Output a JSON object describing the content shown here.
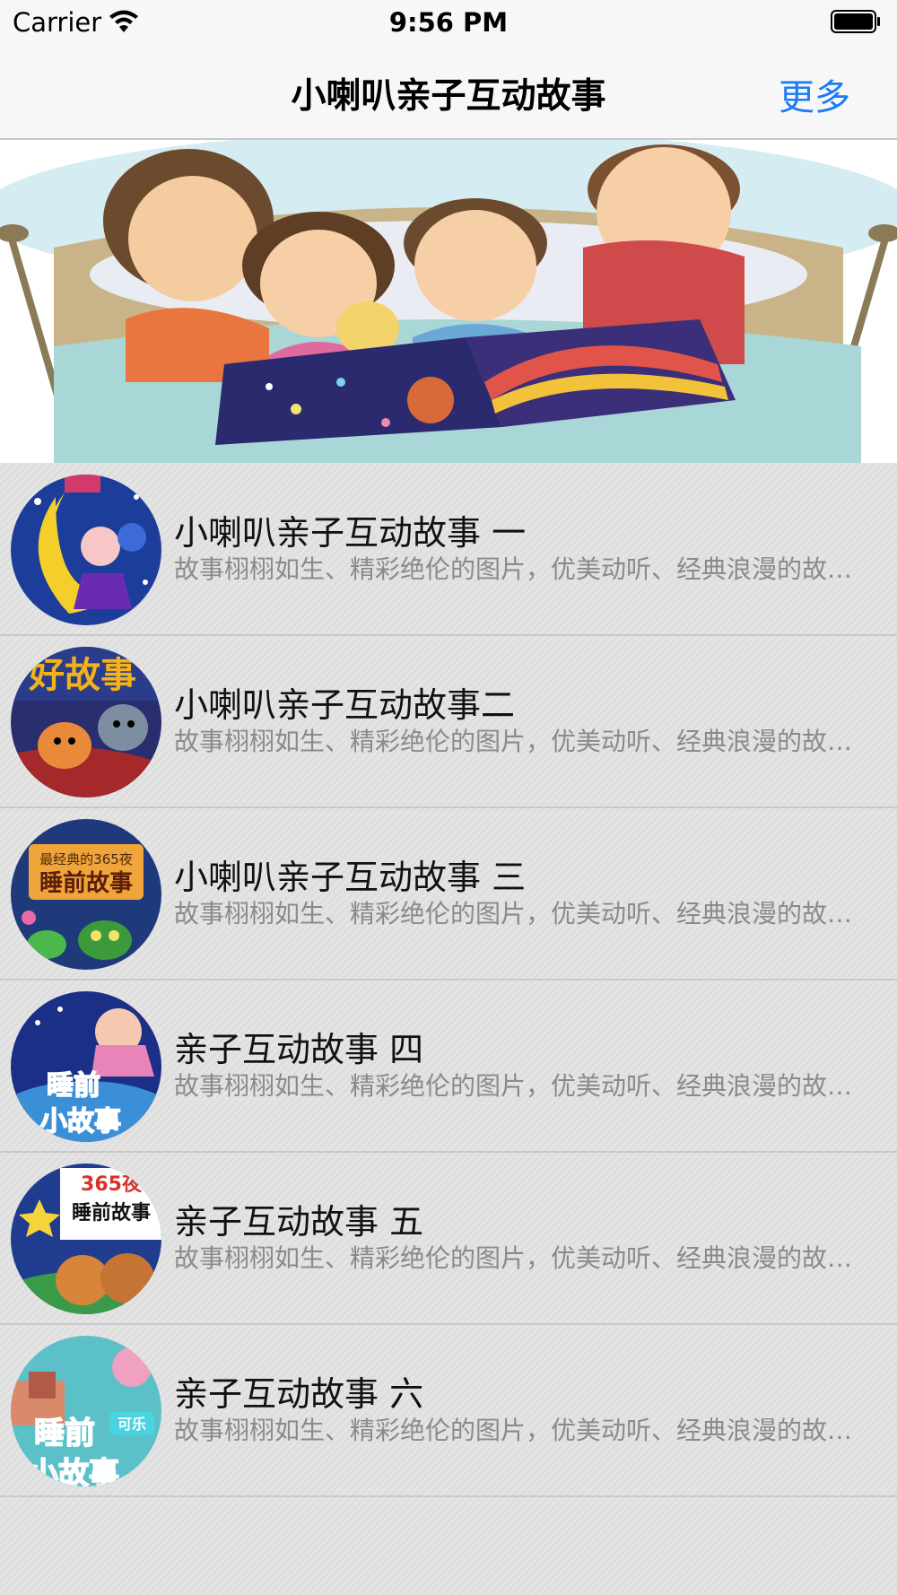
{
  "status_bar": {
    "carrier": "Carrier",
    "time": "9:56 PM",
    "icons": [
      "wifi-icon",
      "battery-icon"
    ]
  },
  "nav": {
    "title": "小喇叭亲子互动故事",
    "more_label": "更多",
    "accent_color": "#1a7cf5"
  },
  "banner": {
    "image": "family-reading-book-illustration"
  },
  "stories": [
    {
      "title": "小喇叭亲子互动故事 一",
      "subtitle": "故事栩栩如生、精彩绝伦的图片，优美动听、经典浪漫的故…",
      "thumb": "moon-children-cover"
    },
    {
      "title": "小喇叭亲子互动故事二",
      "subtitle": "故事栩栩如生、精彩绝伦的图片，优美动听、经典浪漫的故…",
      "thumb": "cats-story-cover",
      "thumb_text": "好故事"
    },
    {
      "title": "小喇叭亲子互动故事 三",
      "subtitle": "故事栩栩如生、精彩绝伦的图片，优美动听、经典浪漫的故…",
      "thumb": "bedtime-stories-365-cover",
      "thumb_text_1": "最经典的365夜",
      "thumb_text_2": "睡前故事"
    },
    {
      "title": "亲子互动故事 四",
      "subtitle": "故事栩栩如生、精彩绝伦的图片，优美动听、经典浪漫的故…",
      "thumb": "bedtime-little-stories-cover",
      "thumb_text_1": "睡前",
      "thumb_text_2": "小故事"
    },
    {
      "title": "亲子互动故事 五",
      "subtitle": "故事栩栩如生、精彩绝伦的图片，优美动听、经典浪漫的故…",
      "thumb": "365-nights-bears-cover",
      "thumb_text_1": "365夜",
      "thumb_text_2": "睡前故事"
    },
    {
      "title": "亲子互动故事 六",
      "subtitle": "故事栩栩如生、精彩绝伦的图片，优美动听、经典浪漫的故…",
      "thumb": "bedtime-stories-kele-cover",
      "thumb_text_1": "睡前",
      "thumb_text_2": "小故事",
      "thumb_text_3": "可乐"
    }
  ]
}
